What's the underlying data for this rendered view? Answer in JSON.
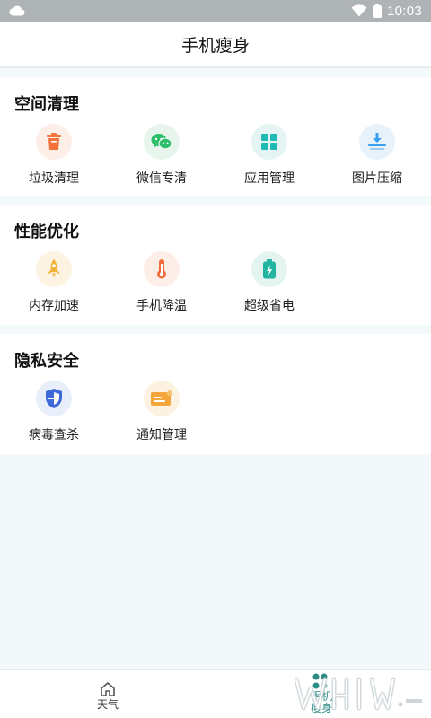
{
  "status_bar": {
    "time": "10:03"
  },
  "header": {
    "title": "手机瘦身"
  },
  "sections": [
    {
      "title": "空间清理",
      "items": [
        {
          "label": "垃圾清理",
          "icon": "trash-can-icon",
          "color": "#f4723b",
          "bg": "#fdeee7"
        },
        {
          "label": "微信专清",
          "icon": "wechat-icon",
          "color": "#2fbf6b",
          "bg": "#e7f5ec"
        },
        {
          "label": "应用管理",
          "icon": "app-grid-icon",
          "color": "#1ebbb4",
          "bg": "#e5f5f4"
        },
        {
          "label": "图片压缩",
          "icon": "download-compress-icon",
          "color": "#3a9ff0",
          "bg": "#e7f2fb"
        }
      ]
    },
    {
      "title": "性能优化",
      "items": [
        {
          "label": "内存加速",
          "icon": "rocket-icon",
          "color": "#f3b23a",
          "bg": "#fdf3e3"
        },
        {
          "label": "手机降温",
          "icon": "thermometer-icon",
          "color": "#ef6b3c",
          "bg": "#fdeee7"
        },
        {
          "label": "超级省电",
          "icon": "battery-icon",
          "color": "#22b4a0",
          "bg": "#e4f4f1"
        }
      ]
    },
    {
      "title": "隐私安全",
      "items": [
        {
          "label": "病毒查杀",
          "icon": "shield-icon",
          "color": "#3f68d8",
          "bg": "#e9eefb"
        },
        {
          "label": "通知管理",
          "icon": "notification-card-icon",
          "color": "#f4a63a",
          "bg": "#fdf1e2"
        }
      ]
    }
  ],
  "bottom_nav": {
    "tabs": [
      {
        "label": "天气",
        "icon": "home-icon",
        "active": false
      },
      {
        "label_line1": "手机",
        "label_line2": "瘦身",
        "icon": "slim-icon",
        "active": true
      }
    ]
  }
}
